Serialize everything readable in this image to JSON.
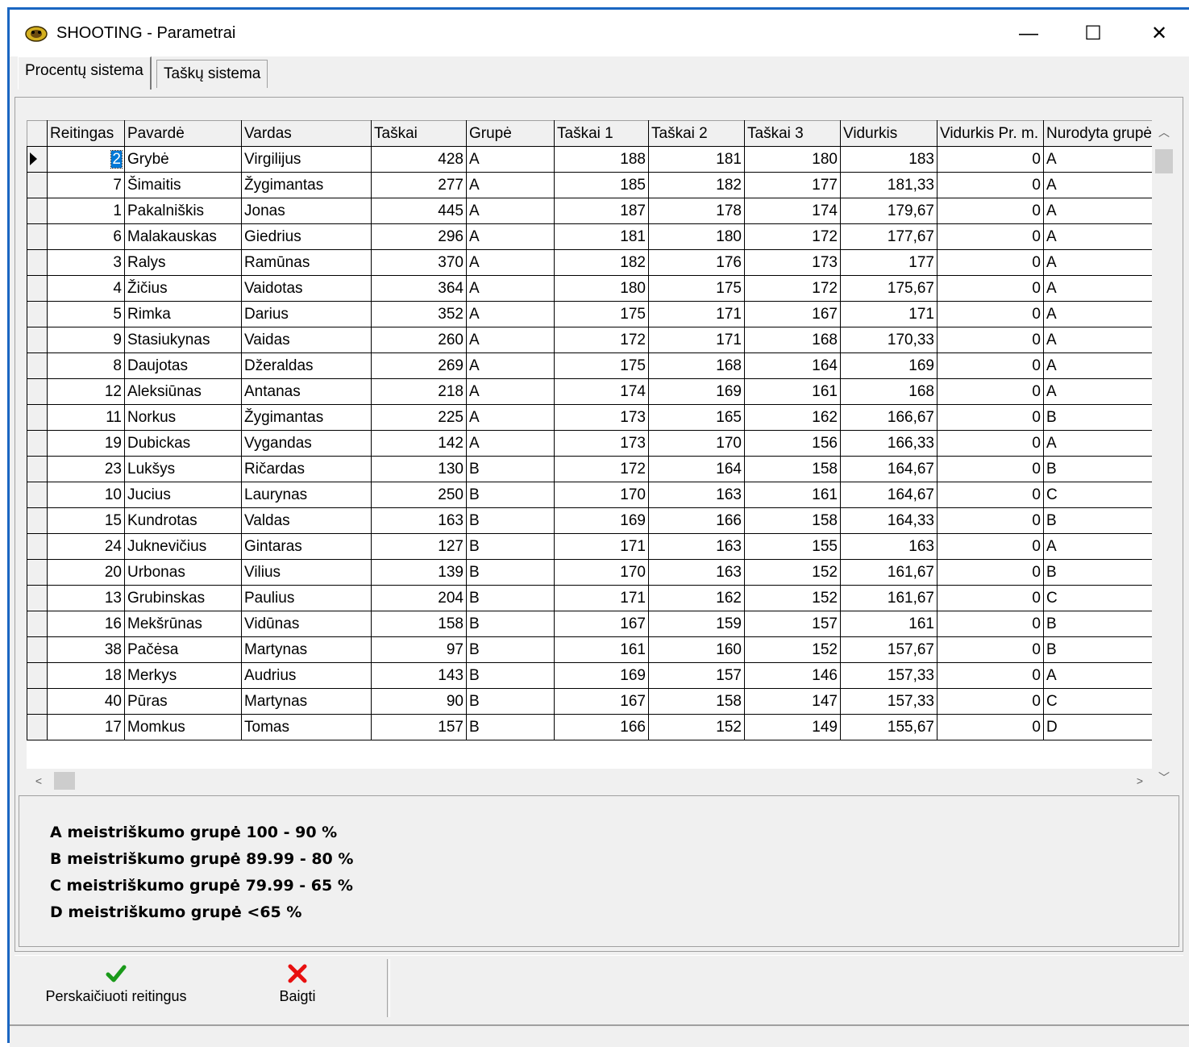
{
  "window": {
    "title": "SHOOTING - Parametrai",
    "minimize": "—",
    "maximize": "☐",
    "close": "✕"
  },
  "tabs": [
    {
      "label": "Procentų sistema",
      "active": true
    },
    {
      "label": "Taškų sistema",
      "active": false
    }
  ],
  "grid": {
    "columns": [
      "Reitingas",
      "Pavardė",
      "Vardas",
      "Taškai",
      "Grupė",
      "Taškai 1",
      "Taškai 2",
      "Taškai 3",
      "Vidurkis",
      "Vidurkis Pr. m.",
      "Nurodyta grupė"
    ],
    "rows": [
      [
        "2",
        "Grybė",
        "Virgilijus",
        "428",
        "A",
        "188",
        "181",
        "180",
        "183",
        "0",
        "A"
      ],
      [
        "7",
        "Šimaitis",
        "Žygimantas",
        "277",
        "A",
        "185",
        "182",
        "177",
        "181,33",
        "0",
        "A"
      ],
      [
        "1",
        "Pakalniškis",
        "Jonas",
        "445",
        "A",
        "187",
        "178",
        "174",
        "179,67",
        "0",
        "A"
      ],
      [
        "6",
        "Malakauskas",
        "Giedrius",
        "296",
        "A",
        "181",
        "180",
        "172",
        "177,67",
        "0",
        "A"
      ],
      [
        "3",
        "Ralys",
        "Ramūnas",
        "370",
        "A",
        "182",
        "176",
        "173",
        "177",
        "0",
        "A"
      ],
      [
        "4",
        "Žičius",
        "Vaidotas",
        "364",
        "A",
        "180",
        "175",
        "172",
        "175,67",
        "0",
        "A"
      ],
      [
        "5",
        "Rimka",
        "Darius",
        "352",
        "A",
        "175",
        "171",
        "167",
        "171",
        "0",
        "A"
      ],
      [
        "9",
        "Stasiukynas",
        "Vaidas",
        "260",
        "A",
        "172",
        "171",
        "168",
        "170,33",
        "0",
        "A"
      ],
      [
        "8",
        "Daujotas",
        "Džeraldas",
        "269",
        "A",
        "175",
        "168",
        "164",
        "169",
        "0",
        "A"
      ],
      [
        "12",
        "Aleksiūnas",
        "Antanas",
        "218",
        "A",
        "174",
        "169",
        "161",
        "168",
        "0",
        "A"
      ],
      [
        "11",
        "Norkus",
        "Žygimantas",
        "225",
        "A",
        "173",
        "165",
        "162",
        "166,67",
        "0",
        "B"
      ],
      [
        "19",
        "Dubickas",
        "Vygandas",
        "142",
        "A",
        "173",
        "170",
        "156",
        "166,33",
        "0",
        "A"
      ],
      [
        "23",
        "Lukšys",
        "Ričardas",
        "130",
        "B",
        "172",
        "164",
        "158",
        "164,67",
        "0",
        "B"
      ],
      [
        "10",
        "Jucius",
        "Laurynas",
        "250",
        "B",
        "170",
        "163",
        "161",
        "164,67",
        "0",
        "C"
      ],
      [
        "15",
        "Kundrotas",
        "Valdas",
        "163",
        "B",
        "169",
        "166",
        "158",
        "164,33",
        "0",
        "B"
      ],
      [
        "24",
        "Juknevičius",
        "Gintaras",
        "127",
        "B",
        "171",
        "163",
        "155",
        "163",
        "0",
        "A"
      ],
      [
        "20",
        "Urbonas",
        "Vilius",
        "139",
        "B",
        "170",
        "163",
        "152",
        "161,67",
        "0",
        "B"
      ],
      [
        "13",
        "Grubinskas",
        "Paulius",
        "204",
        "B",
        "171",
        "162",
        "152",
        "161,67",
        "0",
        "C"
      ],
      [
        "16",
        "Mekšrūnas",
        "Vidūnas",
        "158",
        "B",
        "167",
        "159",
        "157",
        "161",
        "0",
        "B"
      ],
      [
        "38",
        "Pačėsa",
        "Martynas",
        "97",
        "B",
        "161",
        "160",
        "152",
        "157,67",
        "0",
        "B"
      ],
      [
        "18",
        "Merkys",
        "Audrius",
        "143",
        "B",
        "169",
        "157",
        "146",
        "157,33",
        "0",
        "A"
      ],
      [
        "40",
        "Pūras",
        "Martynas",
        "90",
        "B",
        "167",
        "158",
        "147",
        "157,33",
        "0",
        "C"
      ],
      [
        "17",
        "Momkus",
        "Tomas",
        "157",
        "B",
        "166",
        "152",
        "149",
        "155,67",
        "0",
        "D"
      ]
    ]
  },
  "legend": [
    "A meistriškumo grupė 100 - 90 %",
    "B meistriškumo grupė 89.99 - 80 %",
    "C meistriškumo grupė 79.99 - 65 %",
    "D meistriškumo grupė <65 %"
  ],
  "footer": {
    "recalc_label": "Perskaičiuoti reitingus",
    "finish_label": "Baigti"
  },
  "colors": {
    "accent": "#1a66c2",
    "selection": "#0078d7",
    "check": "#1a9a1a",
    "cross": "#e81010"
  }
}
